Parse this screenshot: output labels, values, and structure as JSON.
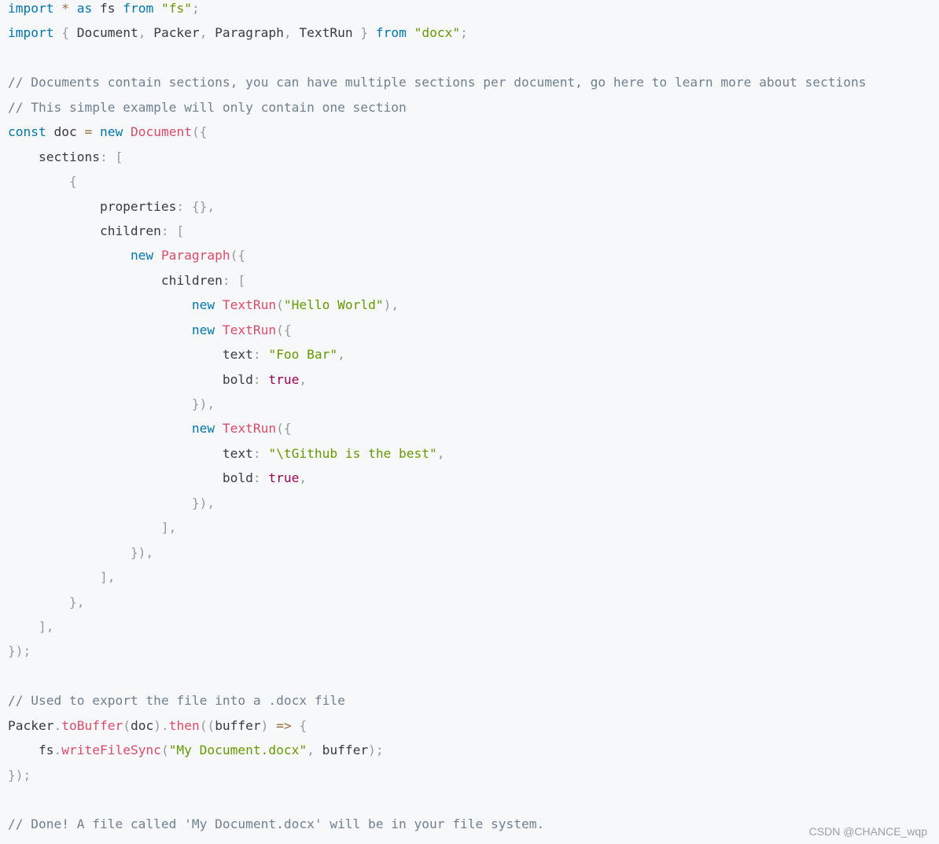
{
  "colors": {
    "background": "#f6f8fa",
    "keyword": "#0077aa",
    "string": "#669900",
    "function": "#dd4a68",
    "punctuation": "#999999",
    "comment": "#708090",
    "boolean": "#990055",
    "operator": "#9a6e3a"
  },
  "watermark": "CSDN @CHANCE_wqp",
  "lines": [
    [
      [
        "kw",
        "import"
      ],
      [
        "plain",
        " "
      ],
      [
        "op",
        "*"
      ],
      [
        "plain",
        " "
      ],
      [
        "kw",
        "as"
      ],
      [
        "plain",
        " fs "
      ],
      [
        "kw",
        "from"
      ],
      [
        "plain",
        " "
      ],
      [
        "str",
        "\"fs\""
      ],
      [
        "punc",
        ";"
      ]
    ],
    [
      [
        "kw",
        "import"
      ],
      [
        "plain",
        " "
      ],
      [
        "punc",
        "{"
      ],
      [
        "plain",
        " Document"
      ],
      [
        "punc",
        ","
      ],
      [
        "plain",
        " Packer"
      ],
      [
        "punc",
        ","
      ],
      [
        "plain",
        " Paragraph"
      ],
      [
        "punc",
        ","
      ],
      [
        "plain",
        " TextRun "
      ],
      [
        "punc",
        "}"
      ],
      [
        "plain",
        " "
      ],
      [
        "kw",
        "from"
      ],
      [
        "plain",
        " "
      ],
      [
        "str",
        "\"docx\""
      ],
      [
        "punc",
        ";"
      ]
    ],
    [],
    [
      [
        "com",
        "// Documents contain sections, you can have multiple sections per document, go here to learn more about sections"
      ]
    ],
    [
      [
        "com",
        "// This simple example will only contain one section"
      ]
    ],
    [
      [
        "kw",
        "const"
      ],
      [
        "plain",
        " doc "
      ],
      [
        "op",
        "="
      ],
      [
        "plain",
        " "
      ],
      [
        "kw",
        "new"
      ],
      [
        "plain",
        " "
      ],
      [
        "fn",
        "Document"
      ],
      [
        "punc",
        "({"
      ]
    ],
    [
      [
        "plain",
        "    sections"
      ],
      [
        "punc",
        ":"
      ],
      [
        "plain",
        " "
      ],
      [
        "punc",
        "["
      ]
    ],
    [
      [
        "plain",
        "        "
      ],
      [
        "punc",
        "{"
      ]
    ],
    [
      [
        "plain",
        "            properties"
      ],
      [
        "punc",
        ":"
      ],
      [
        "plain",
        " "
      ],
      [
        "punc",
        "{},"
      ]
    ],
    [
      [
        "plain",
        "            children"
      ],
      [
        "punc",
        ":"
      ],
      [
        "plain",
        " "
      ],
      [
        "punc",
        "["
      ]
    ],
    [
      [
        "plain",
        "                "
      ],
      [
        "kw",
        "new"
      ],
      [
        "plain",
        " "
      ],
      [
        "fn",
        "Paragraph"
      ],
      [
        "punc",
        "({"
      ]
    ],
    [
      [
        "plain",
        "                    children"
      ],
      [
        "punc",
        ":"
      ],
      [
        "plain",
        " "
      ],
      [
        "punc",
        "["
      ]
    ],
    [
      [
        "plain",
        "                        "
      ],
      [
        "kw",
        "new"
      ],
      [
        "plain",
        " "
      ],
      [
        "fn",
        "TextRun"
      ],
      [
        "punc",
        "("
      ],
      [
        "str",
        "\"Hello World\""
      ],
      [
        "punc",
        "),"
      ]
    ],
    [
      [
        "plain",
        "                        "
      ],
      [
        "kw",
        "new"
      ],
      [
        "plain",
        " "
      ],
      [
        "fn",
        "TextRun"
      ],
      [
        "punc",
        "({"
      ]
    ],
    [
      [
        "plain",
        "                            text"
      ],
      [
        "punc",
        ":"
      ],
      [
        "plain",
        " "
      ],
      [
        "str",
        "\"Foo Bar\""
      ],
      [
        "punc",
        ","
      ]
    ],
    [
      [
        "plain",
        "                            bold"
      ],
      [
        "punc",
        ":"
      ],
      [
        "plain",
        " "
      ],
      [
        "bool",
        "true"
      ],
      [
        "punc",
        ","
      ]
    ],
    [
      [
        "plain",
        "                        "
      ],
      [
        "punc",
        "}),"
      ]
    ],
    [
      [
        "plain",
        "                        "
      ],
      [
        "kw",
        "new"
      ],
      [
        "plain",
        " "
      ],
      [
        "fn",
        "TextRun"
      ],
      [
        "punc",
        "({"
      ]
    ],
    [
      [
        "plain",
        "                            text"
      ],
      [
        "punc",
        ":"
      ],
      [
        "plain",
        " "
      ],
      [
        "str",
        "\"\\tGithub is the best\""
      ],
      [
        "punc",
        ","
      ]
    ],
    [
      [
        "plain",
        "                            bold"
      ],
      [
        "punc",
        ":"
      ],
      [
        "plain",
        " "
      ],
      [
        "bool",
        "true"
      ],
      [
        "punc",
        ","
      ]
    ],
    [
      [
        "plain",
        "                        "
      ],
      [
        "punc",
        "}),"
      ]
    ],
    [
      [
        "plain",
        "                    "
      ],
      [
        "punc",
        "],"
      ]
    ],
    [
      [
        "plain",
        "                "
      ],
      [
        "punc",
        "}),"
      ]
    ],
    [
      [
        "plain",
        "            "
      ],
      [
        "punc",
        "],"
      ]
    ],
    [
      [
        "plain",
        "        "
      ],
      [
        "punc",
        "},"
      ]
    ],
    [
      [
        "plain",
        "    "
      ],
      [
        "punc",
        "],"
      ]
    ],
    [
      [
        "punc",
        "});"
      ]
    ],
    [],
    [
      [
        "com",
        "// Used to export the file into a .docx file"
      ]
    ],
    [
      [
        "plain",
        "Packer"
      ],
      [
        "punc",
        "."
      ],
      [
        "fn",
        "toBuffer"
      ],
      [
        "punc",
        "("
      ],
      [
        "plain",
        "doc"
      ],
      [
        "punc",
        ")."
      ],
      [
        "fn",
        "then"
      ],
      [
        "punc",
        "(("
      ],
      [
        "plain",
        "buffer"
      ],
      [
        "punc",
        ")"
      ],
      [
        "plain",
        " "
      ],
      [
        "op",
        "=>"
      ],
      [
        "plain",
        " "
      ],
      [
        "punc",
        "{"
      ]
    ],
    [
      [
        "plain",
        "    fs"
      ],
      [
        "punc",
        "."
      ],
      [
        "fn",
        "writeFileSync"
      ],
      [
        "punc",
        "("
      ],
      [
        "str",
        "\"My Document.docx\""
      ],
      [
        "punc",
        ","
      ],
      [
        "plain",
        " buffer"
      ],
      [
        "punc",
        ");"
      ]
    ],
    [
      [
        "punc",
        "});"
      ]
    ],
    [],
    [
      [
        "com",
        "// Done! A file called 'My Document.docx' will be in your file system."
      ]
    ]
  ]
}
